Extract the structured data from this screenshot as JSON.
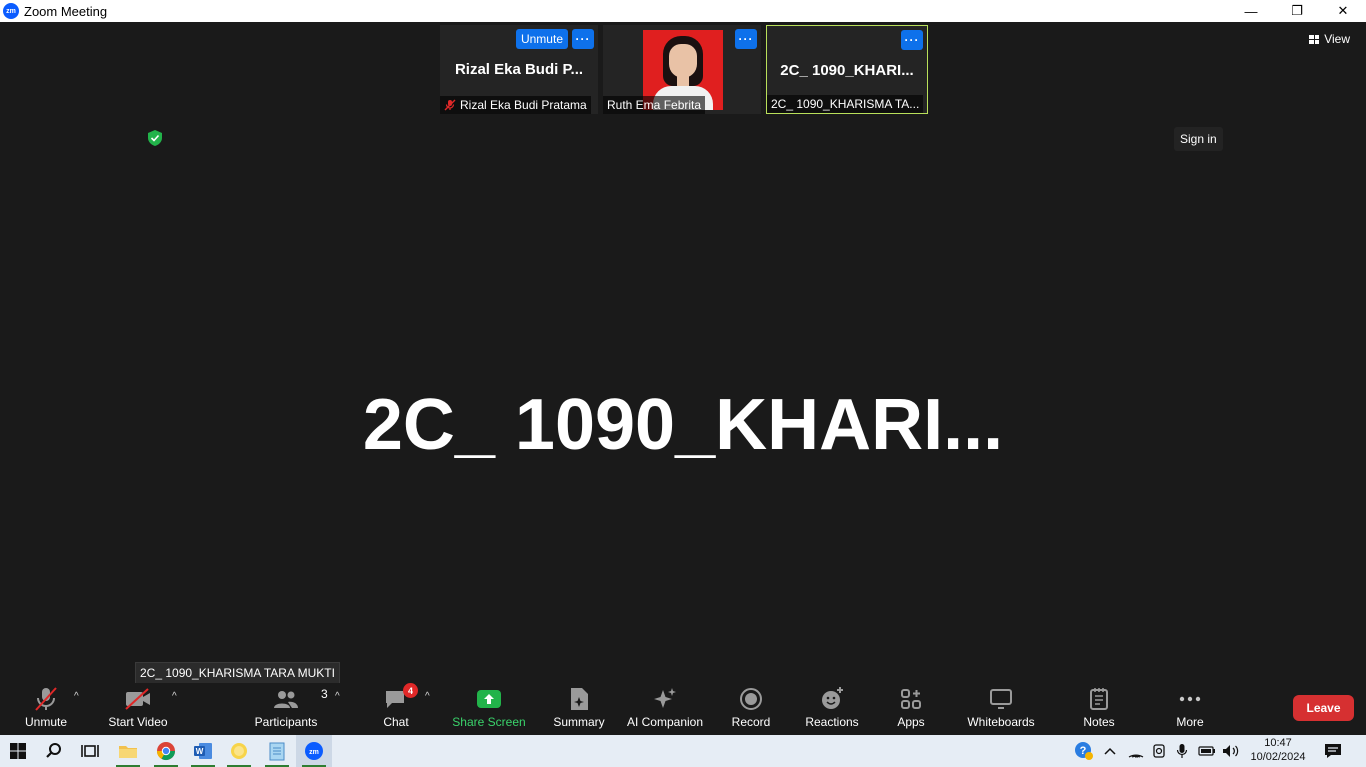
{
  "window": {
    "logo_text": "zm",
    "title": "Zoom Meeting",
    "minimize": "—",
    "restore": "❐",
    "close": "✕"
  },
  "thumbnails": [
    {
      "display_name": "Rizal  Eka  Budi  P...",
      "label": "Rizal Eka Budi Pratama",
      "muted": true,
      "unmute_label": "Unmute",
      "more_label": "···"
    },
    {
      "label": "Ruth Ema Febrita",
      "has_photo": true,
      "more_label": "···"
    },
    {
      "display_name": "2C_  1090_KHARI...",
      "label": "2C_ 1090_KHARISMA TA...",
      "active": true,
      "more_label": "···"
    }
  ],
  "view_button": {
    "label": "View"
  },
  "sign_in": {
    "label": "Sign in"
  },
  "main_speaker": {
    "name": "2C_  1090_KHARI..."
  },
  "speaker_tooltip": "2C_ 1090_KHARISMA TARA MUKTI",
  "toolbar": {
    "unmute": "Unmute",
    "start_video": "Start Video",
    "participants": "Participants",
    "participants_count": "3",
    "chat": "Chat",
    "chat_badge": "4",
    "share_screen": "Share Screen",
    "summary": "Summary",
    "ai_companion": "AI Companion",
    "record": "Record",
    "reactions": "Reactions",
    "apps": "Apps",
    "whiteboards": "Whiteboards",
    "notes": "Notes",
    "more": "More",
    "leave": "Leave",
    "caret": "^"
  },
  "taskbar": {
    "apps": [
      "start-icon",
      "search-icon",
      "task-view-icon",
      "file-explorer-icon",
      "chrome-icon",
      "word-icon",
      "sticky-app-icon",
      "notepad-icon",
      "zoom-icon"
    ],
    "clock_time": "10:47",
    "clock_date": "10/02/2024"
  },
  "colors": {
    "background": "#1a1a1a",
    "zoom_blue": "#0e71eb",
    "active_border": "#b9e05a",
    "share_green": "#3ad36b",
    "leave_red": "#d63031"
  }
}
